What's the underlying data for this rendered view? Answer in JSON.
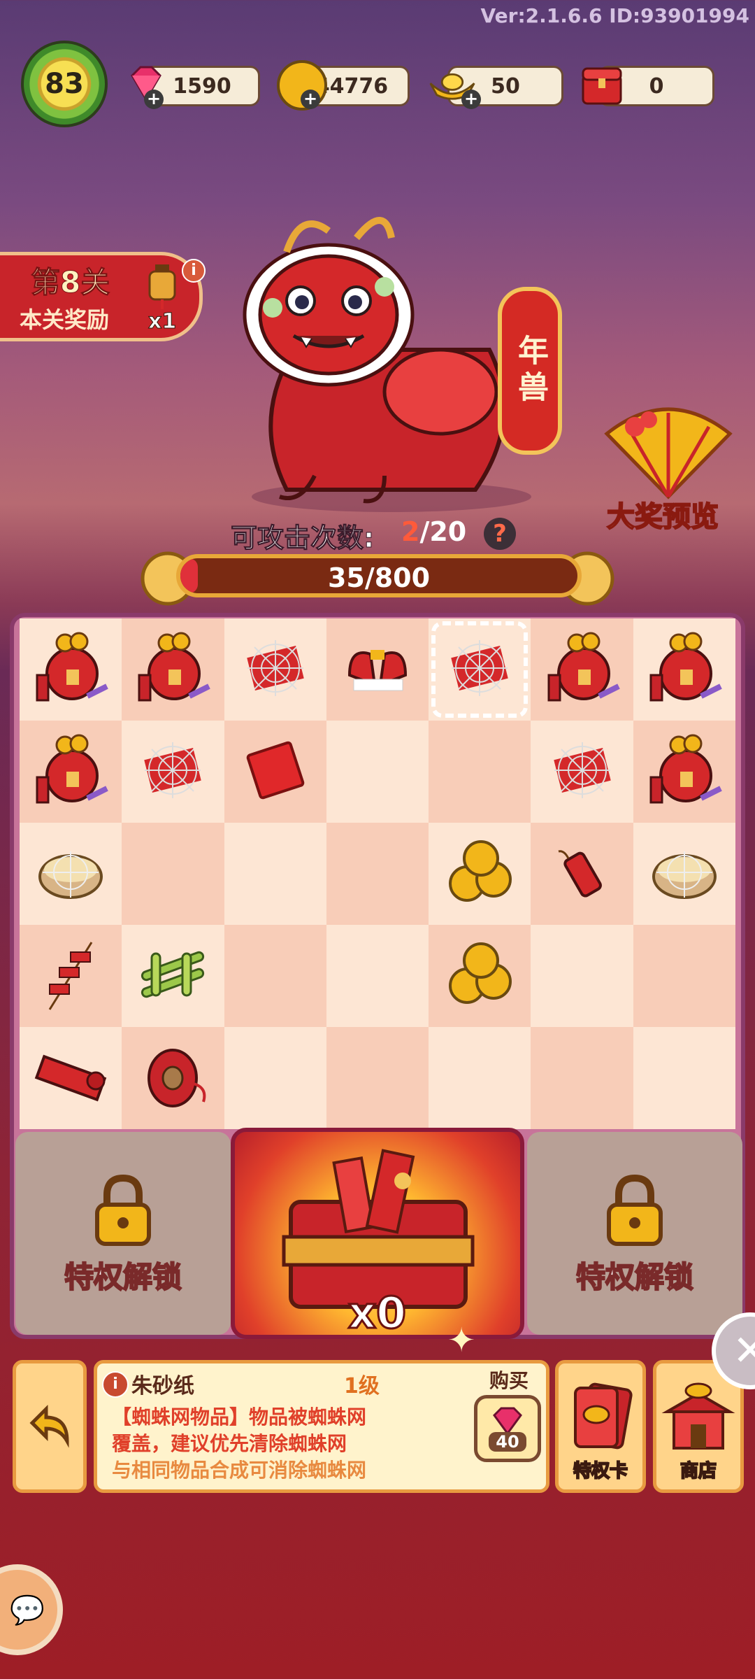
{
  "version": "Ver:2.1.6.6 ID:93901994",
  "player": {
    "level": "83"
  },
  "resources": [
    {
      "name": "gems",
      "icon": "gem-icon",
      "value": "1590"
    },
    {
      "name": "coins",
      "icon": "coin-icon",
      "value": "44776"
    },
    {
      "name": "gold-ingot",
      "icon": "gold-ingot-icon",
      "value": "50"
    },
    {
      "name": "treasure-box",
      "icon": "treasure-box-icon",
      "value": "0"
    }
  ],
  "stage": {
    "title": "第8关",
    "reward_label": "本关奖励",
    "reward_count": "x1"
  },
  "boss": {
    "name": "年兽"
  },
  "grand_prize": {
    "label": "大奖预览"
  },
  "attack": {
    "label": "可攻击次数:",
    "current": "2",
    "max": "/20"
  },
  "hp": {
    "text": "35/800",
    "fraction": 0.04375
  },
  "board": {
    "rows": [
      [
        "lucky-bag",
        "lucky-bag",
        "cobweb-paper",
        "cobweb-gloves",
        "cobweb-paper",
        "lucky-bag",
        "lucky-bag"
      ],
      [
        "lucky-bag",
        "cobweb-paper",
        "red-paper",
        "",
        "",
        "cobweb-paper",
        "lucky-bag"
      ],
      [
        "cobweb-basket",
        "",
        "",
        "",
        "coins",
        "firecracker",
        "cobweb-basket"
      ],
      [
        "firecracker-string",
        "bamboo",
        "",
        "",
        "coins",
        "",
        ""
      ],
      [
        "red-scroll",
        "thread-spool",
        "",
        "",
        "",
        "",
        ""
      ]
    ]
  },
  "locked_slot_label": "特权解锁",
  "chest": {
    "count": "x0"
  },
  "item_info": {
    "name": "朱砂纸",
    "level": "1级",
    "desc_line1": "【蜘蛛网物品】物品被蜘蛛网",
    "desc_line2": "覆盖，建议优先清除蜘蛛网",
    "desc_line3": "与相同物品合成可消除蜘蛛网",
    "buy_label": "购买",
    "price": "40"
  },
  "buttons": {
    "privilege_card": "特权卡",
    "shop": "商店"
  },
  "colors": {
    "accent": "#e0303a",
    "panel": "#fff3cc",
    "border": "#e89a40"
  }
}
